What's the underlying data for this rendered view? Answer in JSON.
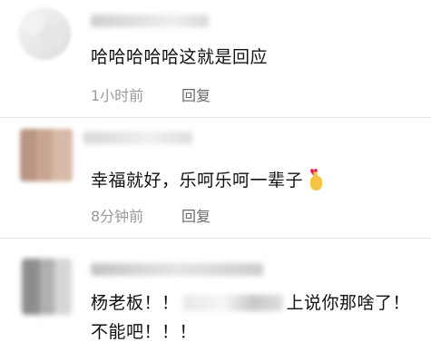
{
  "comments": [
    {
      "text": "哈哈哈哈哈这就是回应",
      "time": "1小时前",
      "reply_label": "回复"
    },
    {
      "text": "幸福就好，乐呵乐呵一辈子",
      "emoji_icon": "pinching-hand-heart-icon",
      "time": "8分钟前",
      "reply_label": "回复"
    },
    {
      "text_before_blur": "杨老板！！",
      "text_after_blur": "上说你那啥了！",
      "text_line2": "不能吧！！！"
    }
  ],
  "colors": {
    "meta": "#9a9a9a",
    "reply": "#6a6a6a",
    "text": "#111111",
    "heart": "#e0245e",
    "hand": "#f5c542"
  }
}
